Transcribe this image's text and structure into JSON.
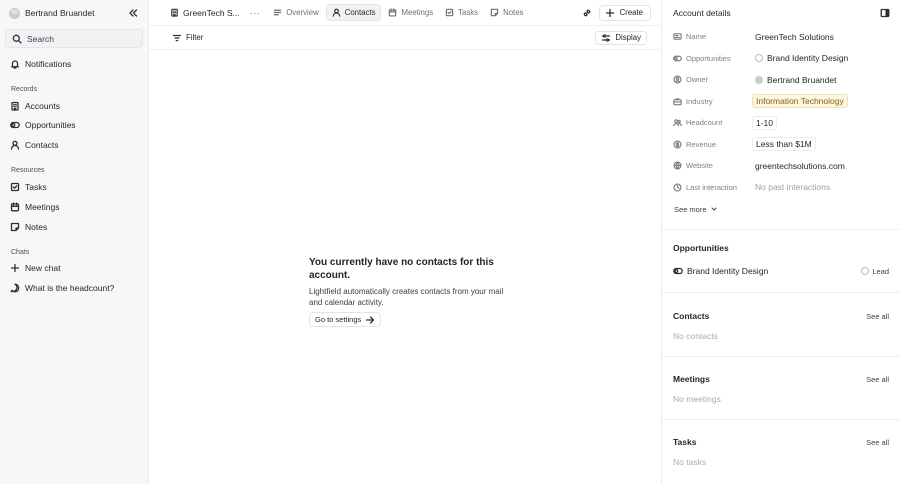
{
  "sidebar": {
    "user": {
      "initials": "BB",
      "name": "Bertrand Bruandet"
    },
    "search_placeholder": "Search",
    "notifications": "Notifications",
    "sections": [
      {
        "title": "Records",
        "items": [
          "Accounts",
          "Opportunities",
          "Contacts"
        ]
      },
      {
        "title": "Resources",
        "items": [
          "Tasks",
          "Meetings",
          "Notes"
        ]
      },
      {
        "title": "Chats",
        "items": [
          "New chat",
          "What is the headcount?"
        ]
      }
    ]
  },
  "tabs": {
    "company": "GreenTech S...",
    "more": "···",
    "items": [
      {
        "label": "Overview",
        "icon": "overview-icon"
      },
      {
        "label": "Contacts",
        "icon": "contacts-icon",
        "active": true
      },
      {
        "label": "Meetings",
        "icon": "calendar-icon"
      },
      {
        "label": "Tasks",
        "icon": "check-square-icon"
      },
      {
        "label": "Notes",
        "icon": "note-icon"
      }
    ],
    "create": "Create"
  },
  "toolbar": {
    "filter": "Filter",
    "display": "Display"
  },
  "empty_state": {
    "title": "You currently have no contacts for this account.",
    "description": "Lightfield automatically creates contacts from your mail and calendar activity.",
    "button": "Go to settings"
  },
  "account": {
    "title": "Account details",
    "fields": [
      {
        "key": "Name",
        "value": "GreenTech Solutions"
      },
      {
        "key": "Opportunities",
        "value": "Brand Identity Design"
      },
      {
        "key": "Owner",
        "value": "Bertrand Bruandet"
      },
      {
        "key": "Industry",
        "value": "Information Technology"
      },
      {
        "key": "Headcount",
        "value": "1-10"
      },
      {
        "key": "Revenue",
        "value": "Less than $1M"
      },
      {
        "key": "Website",
        "value": "greentechsolutions.com"
      },
      {
        "key": "Last interaction",
        "value": "No past interactions"
      }
    ],
    "see_more": "See more",
    "opportunities": {
      "title": "Opportunities",
      "name": "Brand Identity Design",
      "stage": "Lead"
    },
    "contacts": {
      "title": "Contacts",
      "see_all": "See all",
      "empty": "No contacts"
    },
    "meetings": {
      "title": "Meetings",
      "see_all": "See all",
      "empty": "No meetings"
    },
    "tasks": {
      "title": "Tasks",
      "see_all": "See all",
      "empty": "No tasks"
    }
  },
  "colors": {
    "industry_chip_bg": "#fdf6e3",
    "industry_chip_text": "#8a6200",
    "sidebar_bg": "#f7f7f8"
  }
}
